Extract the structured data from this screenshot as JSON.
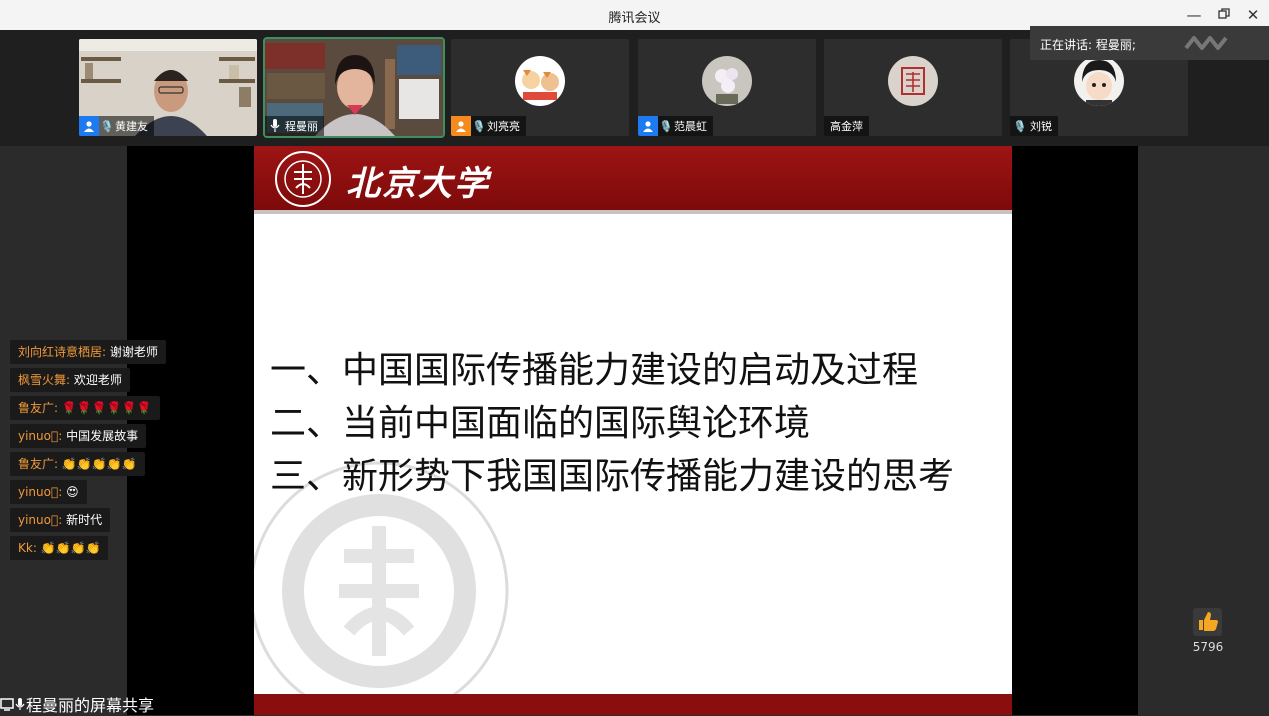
{
  "window": {
    "title": "腾讯会议"
  },
  "participants": [
    {
      "name": "黄建友"
    },
    {
      "name": "程曼丽"
    },
    {
      "name": "刘亮亮"
    },
    {
      "name": "范晨虹"
    },
    {
      "name": "高金萍"
    },
    {
      "name": "刘锐"
    }
  ],
  "speaking": {
    "text": "正在讲话: 程曼丽;"
  },
  "slide": {
    "header": "北京大学",
    "items": [
      "一、中国国际传播能力建设的启动及过程",
      "二、当前中国面临的国际舆论环境",
      "三、新形势下我国国际传播能力建设的思考"
    ]
  },
  "chat": [
    {
      "user": "刘向红诗意栖居:",
      "text": "谢谢老师"
    },
    {
      "user": "枫雪火舞:",
      "text": "欢迎老师"
    },
    {
      "user": "鲁友广:",
      "text": "🌹🌹🌹🌹🌹🌹"
    },
    {
      "user": "yinuo⃞:",
      "text": "中国发展故事"
    },
    {
      "user": "鲁友广:",
      "text": "👏👏👏👏👏"
    },
    {
      "user": "yinuo⃞:",
      "text": "😍"
    },
    {
      "user": "yinuo⃞:",
      "text": "新时代"
    },
    {
      "user": "Kk:",
      "text": "👏👏👏👏"
    }
  ],
  "likes": {
    "count": "5796"
  },
  "share": {
    "label": "程曼丽的屏幕共享"
  },
  "colors": {
    "accent_green": "#3d8f5d",
    "pku_red": "#8a0e0e",
    "chat_user": "#f0993a"
  }
}
